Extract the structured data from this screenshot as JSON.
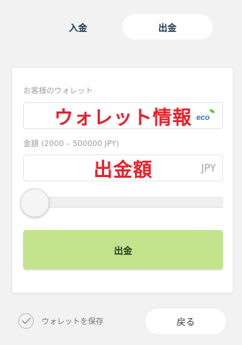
{
  "tabs": {
    "deposit": "入金",
    "withdraw": "出金"
  },
  "form": {
    "wallet_label": "お客様のウォレット",
    "wallet_overlay": "ウォレット情報",
    "wallet_provider_logo": "eco",
    "amount_label": "金額 (2000 – 500000 JPY)",
    "amount_overlay": "出金額",
    "currency": "JPY",
    "slider_value": 0,
    "submit_label": "出金"
  },
  "footer": {
    "save_wallet_label": "ウォレットを保存",
    "save_wallet_checked": true,
    "back_label": "戻る"
  },
  "colors": {
    "background": "#f2f2f2",
    "submit_button": "#c3e48d",
    "overlay_text": "#e8202a",
    "eco_blue": "#2b77c7",
    "eco_green": "#6cbf2b"
  }
}
